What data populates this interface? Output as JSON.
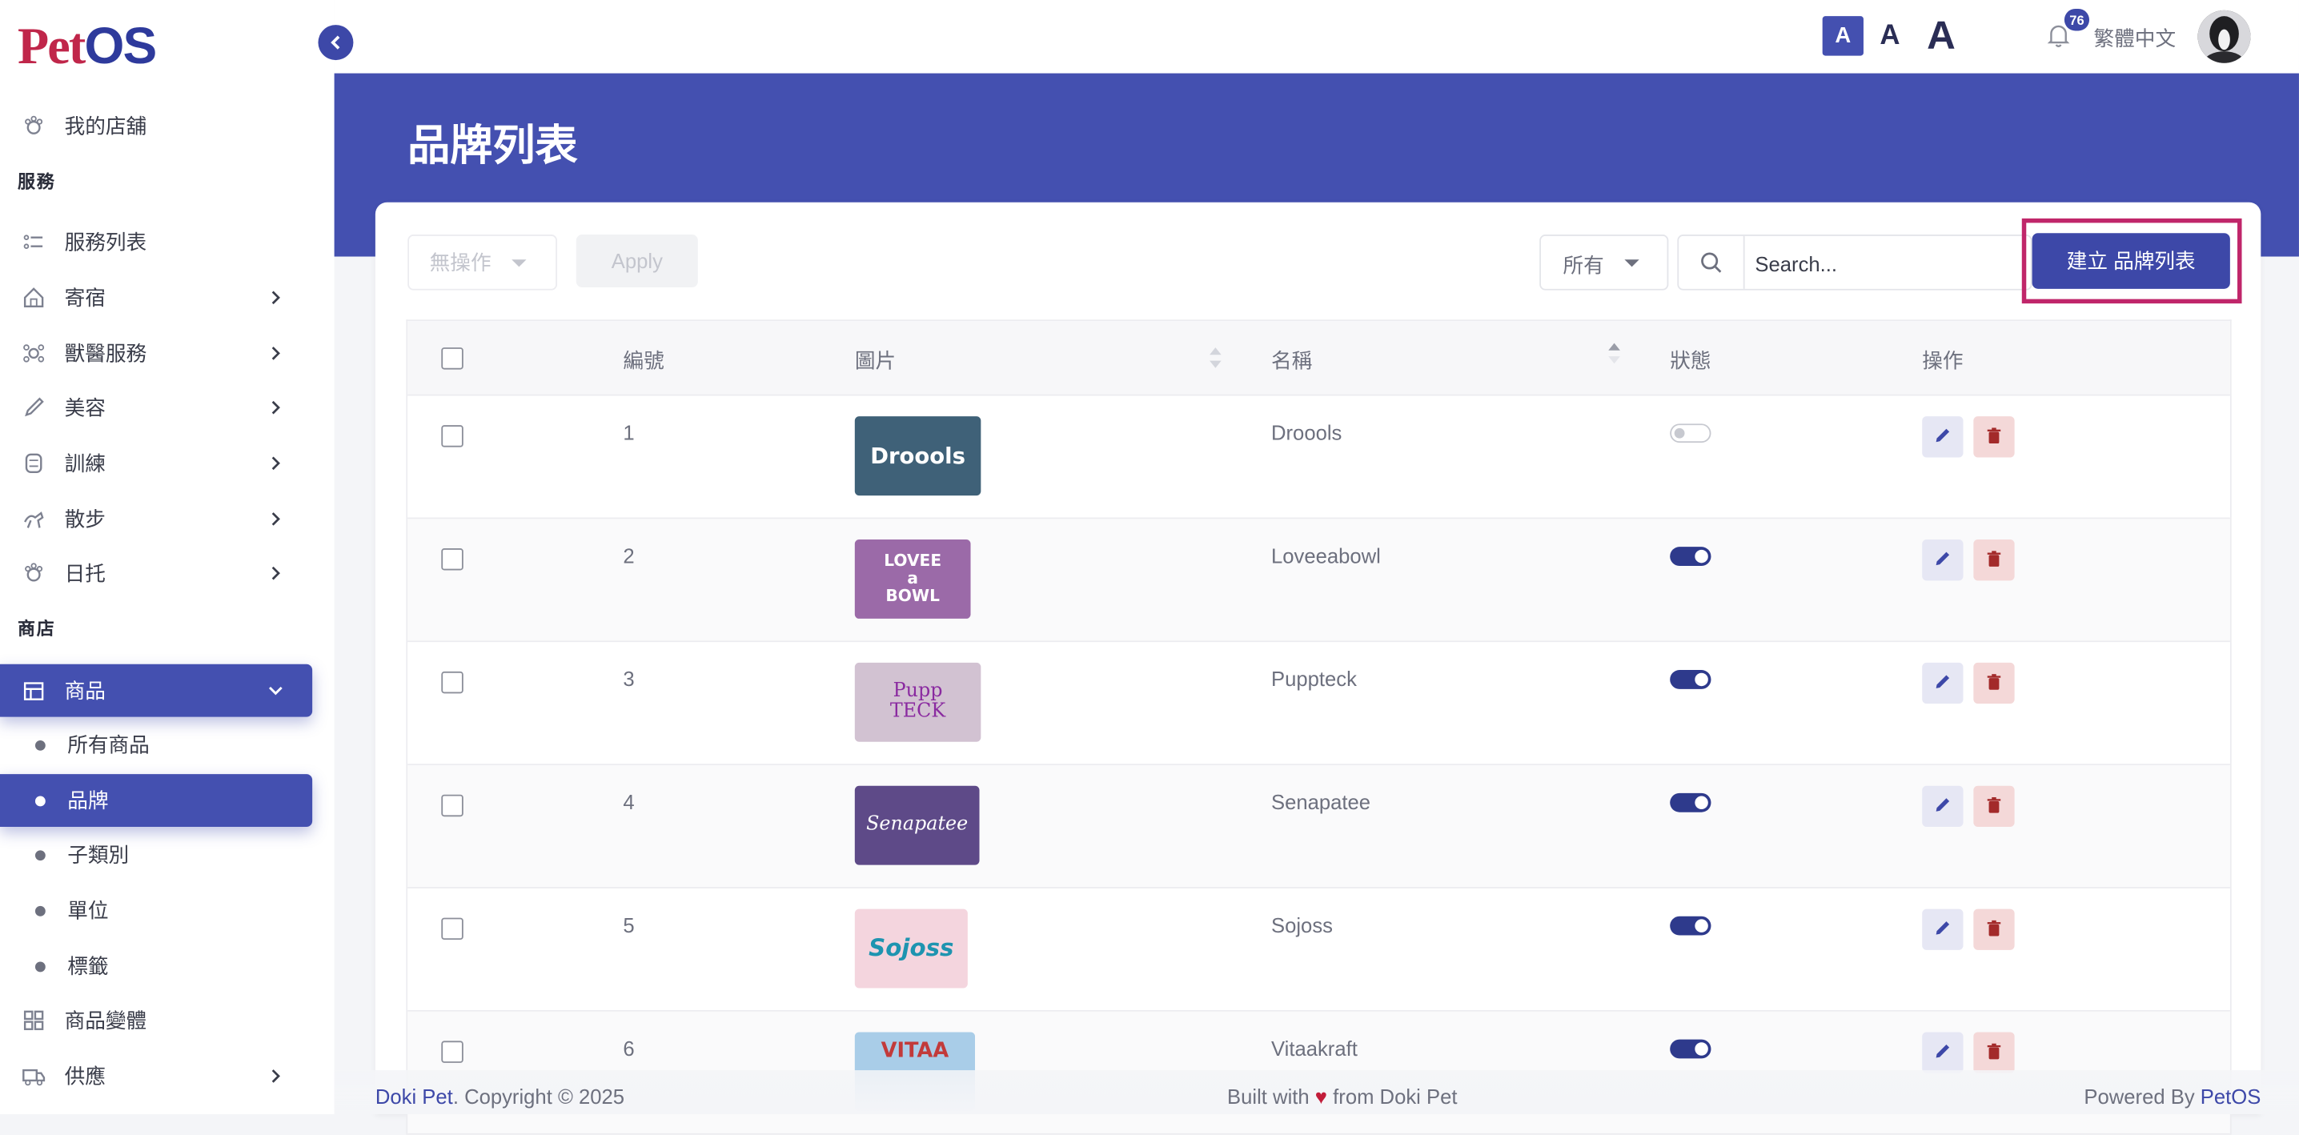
{
  "app": {
    "logo_pet": "Pet",
    "logo_os": "OS"
  },
  "sidebar": {
    "my_store": "我的店舖",
    "section_service": "服務",
    "service_items": [
      {
        "label": "服務列表",
        "icon": "list-icon",
        "has_chevron": false
      },
      {
        "label": "寄宿",
        "icon": "home-icon",
        "has_chevron": true
      },
      {
        "label": "獸醫服務",
        "icon": "vet-icon",
        "has_chevron": true
      },
      {
        "label": "美容",
        "icon": "brush-icon",
        "has_chevron": true
      },
      {
        "label": "訓練",
        "icon": "training-icon",
        "has_chevron": true
      },
      {
        "label": "散步",
        "icon": "walk-icon",
        "has_chevron": true
      },
      {
        "label": "日托",
        "icon": "daycare-icon",
        "has_chevron": true
      }
    ],
    "section_shop": "商店",
    "products": "商品",
    "product_subitems": [
      "所有商品",
      "品牌",
      "子類別",
      "單位",
      "標籤"
    ],
    "active_subitem": "品牌",
    "product_variants": "商品變體",
    "supply": "供應"
  },
  "header": {
    "font_size_labels": [
      "A",
      "A",
      "A"
    ],
    "notification_count": "76",
    "language": "繁體中文"
  },
  "page": {
    "title": "品牌列表"
  },
  "toolbar": {
    "bulk_action": "無操作",
    "apply_label": "Apply",
    "filter_value": "所有",
    "search_placeholder": "Search...",
    "create_label": "建立 品牌列表"
  },
  "table": {
    "headers": {
      "id": "編號",
      "image": "圖片",
      "name": "名稱",
      "status": "狀態",
      "actions": "操作"
    },
    "rows": [
      {
        "id": "1",
        "name": "Droools",
        "logo_text": "Droools",
        "logo_bg": "#3f6178",
        "logo_color": "#ffffff",
        "status_on": false
      },
      {
        "id": "2",
        "name": "Loveeabowl",
        "logo_text": "LOVEE a BOWL",
        "logo_bg": "#9b6aa8",
        "logo_color": "#ffffff",
        "status_on": true
      },
      {
        "id": "3",
        "name": "Puppteck",
        "logo_text": "Pupp TECK",
        "logo_bg": "#d2c2d2",
        "logo_color": "#8a2aa0",
        "status_on": true
      },
      {
        "id": "4",
        "name": "Senapatee",
        "logo_text": "Senapatee",
        "logo_bg": "#5e4a88",
        "logo_color": "#ffffff",
        "status_on": true
      },
      {
        "id": "5",
        "name": "Sojoss",
        "logo_text": "Sojoss",
        "logo_bg": "#f4d5de",
        "logo_color": "#1e94b0",
        "status_on": true
      },
      {
        "id": "6",
        "name": "Vitaakraft",
        "logo_text": "VITAA",
        "logo_bg": "#a9cde8",
        "logo_color": "#c23a3a",
        "status_on": true
      }
    ]
  },
  "footer": {
    "brand": "Doki Pet",
    "copyright": ". Copyright © 2025",
    "built_prefix": "Built with",
    "built_suffix": "from Doki Pet",
    "powered_prefix": "Powered By",
    "powered_brand": "PetOS"
  },
  "colors": {
    "primary": "#4450b0",
    "accent_frame": "#c0266a",
    "delete": "#a32a2a"
  }
}
